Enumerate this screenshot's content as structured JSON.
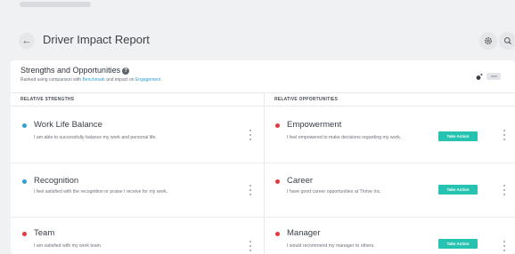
{
  "header": {
    "title": "Driver Impact Report"
  },
  "section": {
    "title": "Strengths and Opportunities",
    "subtitle_prefix": "Ranked using comparison with ",
    "subtitle_link1": "Benchmark",
    "subtitle_middle": " and impact on ",
    "subtitle_link2": "Engagement"
  },
  "columns": {
    "left": "RELATIVE STRENGTHS",
    "right": "RELATIVE OPPORTUNITIES"
  },
  "strengths": [
    {
      "name": "Work Life Balance",
      "desc": "I am able to successfully balance my work and personal life."
    },
    {
      "name": "Recognition",
      "desc": "I feel satisfied with the recognition or praise I receive for my work."
    },
    {
      "name": "Team",
      "desc": "I am satisfied with my work team."
    }
  ],
  "opportunities": [
    {
      "name": "Empowerment",
      "desc": "I feel empowered to make decisions regarding my work.",
      "action": "Take Action"
    },
    {
      "name": "Career",
      "desc": "I have good career opportunities at Thrive Inc.",
      "action": "Take Action"
    },
    {
      "name": "Manager",
      "desc": "I would recommend my manager to others.",
      "action": "Take Action"
    }
  ],
  "colors": {
    "strength_dot": "#2f9fd0",
    "opportunity_dot": "#e5383b",
    "action": "#27c3b1"
  },
  "icons": {
    "back": "arrow-left-icon",
    "settings": "gear-icon",
    "search": "search-icon",
    "more": "more-vertical-icon",
    "help": "help-circle-icon"
  }
}
